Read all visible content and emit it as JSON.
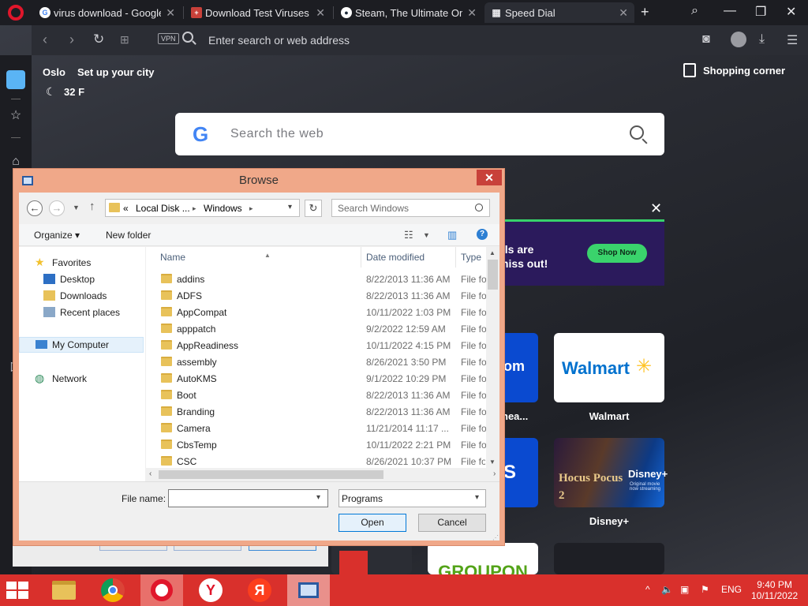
{
  "browser": {
    "tabs": [
      {
        "title": "virus download - Google S",
        "favicon": "google-icon"
      },
      {
        "title": "Download Test Viruses - Ik",
        "favicon": "page-icon"
      },
      {
        "title": "Steam, The Ultimate Onlin",
        "favicon": "steam-icon"
      },
      {
        "title": "Speed Dial",
        "favicon": "speed-dial-icon",
        "active": true
      }
    ],
    "address_placeholder": "Enter search or web address",
    "vpn_label": "VPN"
  },
  "speed_dial": {
    "city": "Oslo",
    "set_city": "Set up your city",
    "temperature": "32 F",
    "shopping_corner": "Shopping corner",
    "search_placeholder": "Search the web",
    "search_logo": "G",
    "promo": {
      "text_line1": "als are",
      "text_line2": "miss out!",
      "button": "Shop Now",
      "close": "✕"
    },
    "tiles": [
      {
        "name": "Walmart",
        "logo": "Walmart"
      },
      {
        "name": "Disney+",
        "art_title": "Hocus Pocus 2",
        "brand": "Disney+",
        "sub": "Original movie now streaming"
      },
      {
        "name": "partial-heal",
        "label": "hea..."
      },
      {
        "name": "partial-com",
        "label": "om"
      },
      {
        "name": "Groupon",
        "logo": "GROUPON"
      }
    ]
  },
  "dialog": {
    "title": "Browse",
    "breadcrumb": [
      "«",
      "Local Disk ...",
      "Windows"
    ],
    "search_placeholder": "Search Windows",
    "toolbar": {
      "organize": "Organize",
      "new_folder": "New folder"
    },
    "nav": {
      "favorites": "Favorites",
      "desktop": "Desktop",
      "downloads": "Downloads",
      "recent": "Recent places",
      "computer": "My Computer",
      "network": "Network"
    },
    "columns": {
      "name": "Name",
      "date": "Date modified",
      "type": "Type"
    },
    "files": [
      {
        "name": "addins",
        "date": "8/22/2013 11:36 AM",
        "type": "File folder"
      },
      {
        "name": "ADFS",
        "date": "8/22/2013 11:36 AM",
        "type": "File folder"
      },
      {
        "name": "AppCompat",
        "date": "10/11/2022 1:03 PM",
        "type": "File folder"
      },
      {
        "name": "apppatch",
        "date": "9/2/2022 12:59 AM",
        "type": "File folder"
      },
      {
        "name": "AppReadiness",
        "date": "10/11/2022 4:15 PM",
        "type": "File folder"
      },
      {
        "name": "assembly",
        "date": "8/26/2021 3:50 PM",
        "type": "File folder"
      },
      {
        "name": "AutoKMS",
        "date": "9/1/2022 10:29 PM",
        "type": "File folder"
      },
      {
        "name": "Boot",
        "date": "8/22/2013 11:36 AM",
        "type": "File folder"
      },
      {
        "name": "Branding",
        "date": "8/22/2013 11:36 AM",
        "type": "File folder"
      },
      {
        "name": "Camera",
        "date": "11/21/2014 11:17 ...",
        "type": "File folder"
      },
      {
        "name": "CbsTemp",
        "date": "10/11/2022 2:21 PM",
        "type": "File folder"
      },
      {
        "name": "CSC",
        "date": "8/26/2021 10:37 PM",
        "type": "File folder"
      }
    ],
    "file_name_label": "File name:",
    "file_name_value": "",
    "file_type": "Programs",
    "open": "Open",
    "cancel": "Cancel"
  },
  "taskbar": {
    "apps": [
      "file-explorer",
      "chrome",
      "opera",
      "yandex",
      "yandex-alt",
      "dialog-app"
    ],
    "language": "ENG",
    "time": "9:40 PM",
    "date": "10/11/2022"
  },
  "colors": {
    "taskbar": "#d9302c",
    "dialog_frame": "#f0a889",
    "accent_blue": "#5ab4f5",
    "promo_green": "#3ad36c"
  }
}
